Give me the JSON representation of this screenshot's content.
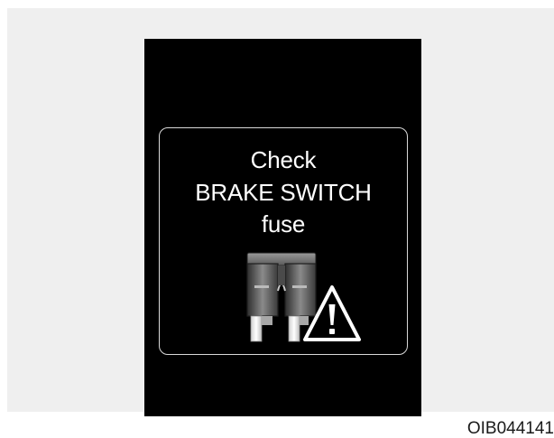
{
  "display": {
    "message": {
      "line1": "Check",
      "line2": "BRAKE SWITCH",
      "line3": "fuse"
    },
    "icons": [
      "fuse-icon",
      "warning-triangle-icon"
    ]
  },
  "caption": {
    "code": "OIB044141"
  },
  "colors": {
    "display_background": "#000000",
    "message_text": "#ffffff",
    "frame_border": "#d9d9d9",
    "page_background": "#efefef"
  }
}
